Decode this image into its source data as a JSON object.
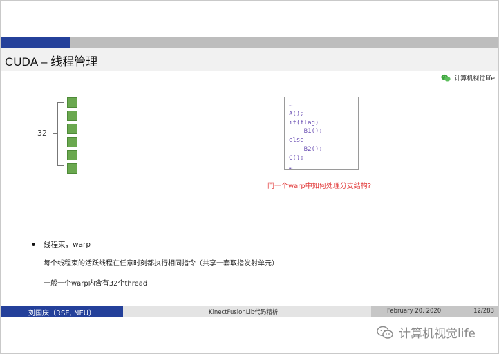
{
  "slide": {
    "title": "CUDA – 线程管理",
    "watermark_small": "计算机视觉life"
  },
  "diagram": {
    "warp_size_label": "32",
    "thread_icons": 6,
    "thread_color": "#6aa84f"
  },
  "code": {
    "lines": [
      "…",
      "A();",
      "if(flag)",
      "    B1();",
      "else",
      "    B2();",
      "C();",
      "…"
    ],
    "caption": "同一个warp中如何处理分支结构?"
  },
  "bullets": {
    "item": "线程束，warp",
    "line1": "每个线程束的活跃线程在任意时刻都执行相同指令（共享一套取指发射单元）",
    "line2": "一般一个warp内含有32个thread"
  },
  "footer": {
    "author": "刘国庆（RSE, NEU）",
    "title": "KinectFusionLib代码精析",
    "date": "February 20, 2020",
    "pages": "12/283"
  },
  "watermark": {
    "big": "计算机视觉life"
  },
  "colors": {
    "accent": "#24409a",
    "caption_red": "#e23b3b",
    "code_purple": "#6a4fb3"
  }
}
